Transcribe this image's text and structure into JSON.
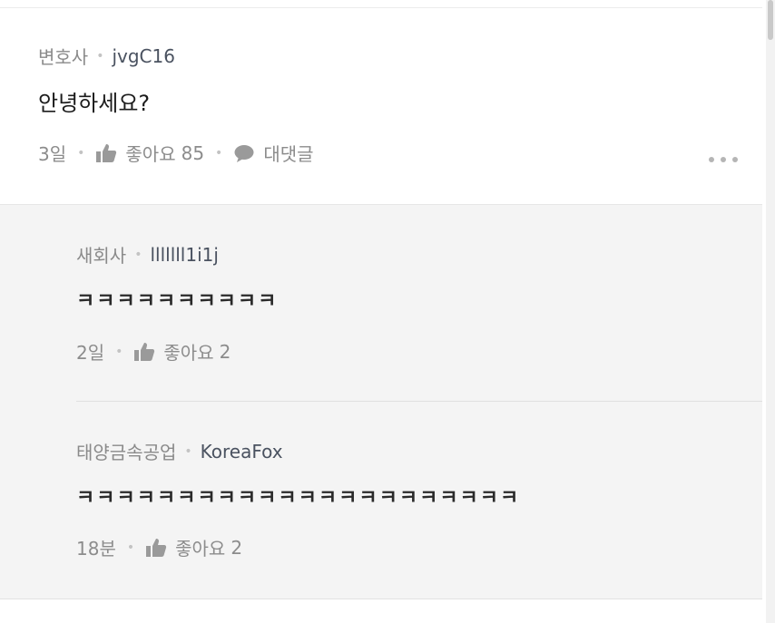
{
  "main_comment": {
    "company": "변호사",
    "nickname": "jvgC16",
    "text": "안녕하세요?",
    "time": "3일",
    "like_label": "좋아요",
    "like_count": "85",
    "reply_label": "대댓글"
  },
  "replies": [
    {
      "company": "새회사",
      "nickname": "lllllll1i1j",
      "text": "ㅋㅋㅋㅋㅋㅋㅋㅋㅋㅋ",
      "time": "2일",
      "like_label": "좋아요",
      "like_count": "2"
    },
    {
      "company": "태양금속공업",
      "nickname": "KoreaFox",
      "text": "ㅋㅋㅋㅋㅋㅋㅋㅋㅋㅋㅋㅋㅋㅋㅋㅋㅋㅋㅋㅋㅋㅋ",
      "time": "18분",
      "like_label": "좋아요",
      "like_count": "2"
    }
  ],
  "icons": {
    "like": "thumbs-up-icon",
    "reply": "speech-bubble-icon",
    "more": "more-horizontal-icon"
  },
  "colors": {
    "reply_background": "#f4f4f4",
    "meta_text": "#8a8a8a",
    "nickname_text": "#4a5260",
    "body_text": "#1c1c1c"
  }
}
